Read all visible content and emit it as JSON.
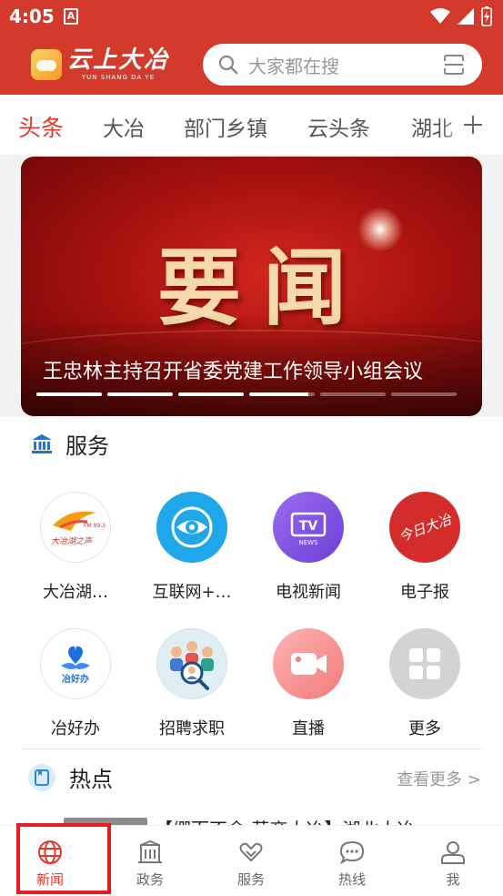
{
  "status_bar": {
    "time": "4:05",
    "notification_badge": "A"
  },
  "header": {
    "app_name": "云上大冶",
    "app_name_en": "YUN SHANG DA YE",
    "search_placeholder": "大家都在搜"
  },
  "tabs": [
    "头条",
    "大冶",
    "部门乡镇",
    "云头条",
    "湖北"
  ],
  "active_tab": 0,
  "banner": {
    "image_text": "要闻",
    "caption": "王忠林主持召开省委党建工作领导小组会议",
    "slide_count": 6,
    "active_slide_progress": 3.9
  },
  "services": {
    "title": "服务",
    "items": [
      {
        "label": "大冶湖…",
        "icon": "radio-logo-icon",
        "logo_text": "大冶湖之声",
        "logo_sub": "FM 99.3"
      },
      {
        "label": "互联网+…",
        "icon": "eye-icon"
      },
      {
        "label": "电视新闻",
        "icon": "tv-icon",
        "logo_text": "TV",
        "logo_sub": "NEWS"
      },
      {
        "label": "电子报",
        "icon": "newspaper-logo-icon",
        "logo_text": "今日大冶"
      },
      {
        "label": "冶好办",
        "icon": "hand-heart-icon",
        "logo_text": "冶好办"
      },
      {
        "label": "招聘求职",
        "icon": "recruitment-icon"
      },
      {
        "label": "直播",
        "icon": "video-camera-icon"
      },
      {
        "label": "更多",
        "icon": "grid-icon"
      }
    ]
  },
  "hot": {
    "title": "热点",
    "more_label": "查看更多 >",
    "first_item_text": "【绷而不舍 营商大冶】湖北大冶"
  },
  "bottom_nav": [
    {
      "label": "新闻",
      "icon": "globe-icon",
      "active": true
    },
    {
      "label": "政务",
      "icon": "building-icon",
      "active": false
    },
    {
      "label": "服务",
      "icon": "heart-hands-icon",
      "active": false
    },
    {
      "label": "热线",
      "icon": "chat-bubble-icon",
      "active": false
    },
    {
      "label": "我",
      "icon": "user-icon",
      "active": false
    }
  ],
  "colors": {
    "brand_red": "#d33a2c",
    "active_red": "#e0382b",
    "highlight_box": "#e81b23"
  }
}
